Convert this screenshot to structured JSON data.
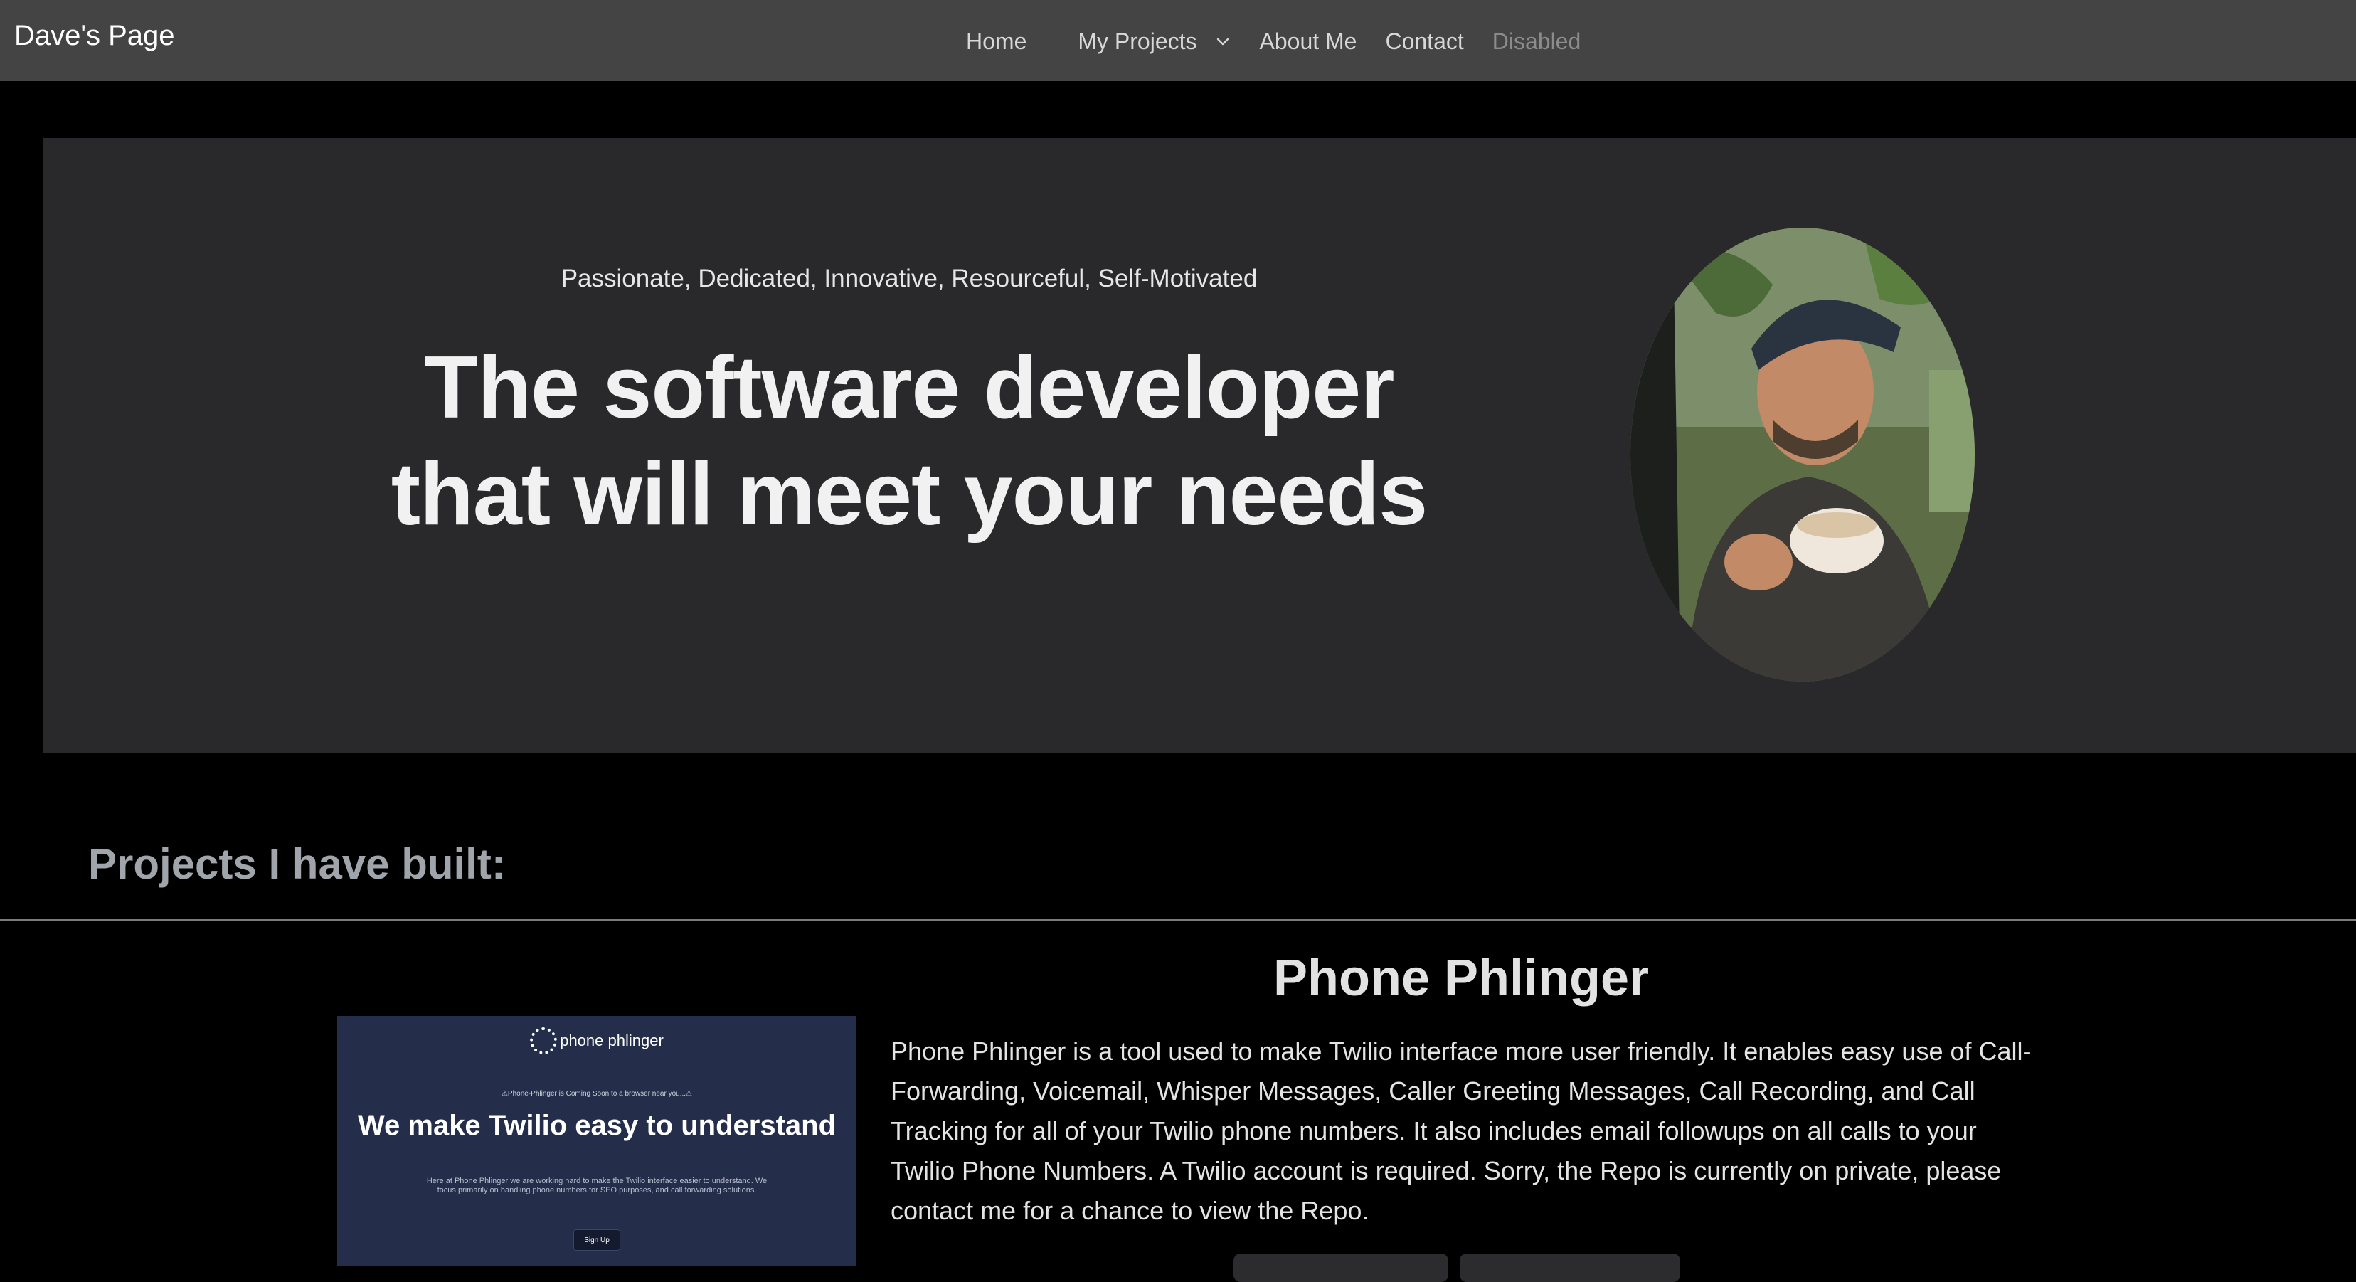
{
  "navbar": {
    "brand": "Dave's Page",
    "links": {
      "home": "Home",
      "projects": "My Projects",
      "about": "About Me",
      "contact": "Contact",
      "disabled": "Disabled"
    }
  },
  "hero": {
    "tagline": "Passionate, Dedicated, Innovative, Resourceful, Self-Motivated",
    "headline": "The software developer that will meet your needs"
  },
  "projects": {
    "section_title": "Projects I have built:",
    "items": [
      {
        "title": "Phone Phlinger",
        "description": "Phone Phlinger is a tool used to make Twilio interface more user friendly. It enables easy use of Call-Forwarding, Voicemail, Whisper Messages, Caller Greeting Messages, Call Recording, and Call Tracking for all of your Twilio phone numbers. It also includes email followups on all calls to your Twilio Phone Numbers. A Twilio account is required. Sorry, the Repo is currently on private, please contact me for a chance to view the Repo.",
        "thumbnail": {
          "logo": "phone phlinger",
          "notice": "⚠Phone-Phlinger is Coming Soon to a browser near you...⚠",
          "heading": "We make Twilio easy to understand",
          "body": "Here at Phone Phlinger we are working hard to make the Twilio interface easier to understand. We focus primarily on handling phone numbers for SEO purposes, and call forwarding solutions.",
          "button": "Sign Up"
        }
      }
    ]
  },
  "colors": {
    "navbar_bg": "#444444",
    "hero_bg": "#29292b",
    "page_bg": "#000000",
    "section_title": "#a0a4ab",
    "thumb_bg": "#242d4a"
  },
  "icons": {
    "dropdown": "chevron-down-icon",
    "thumb_logo": "phone-ring-icon"
  }
}
